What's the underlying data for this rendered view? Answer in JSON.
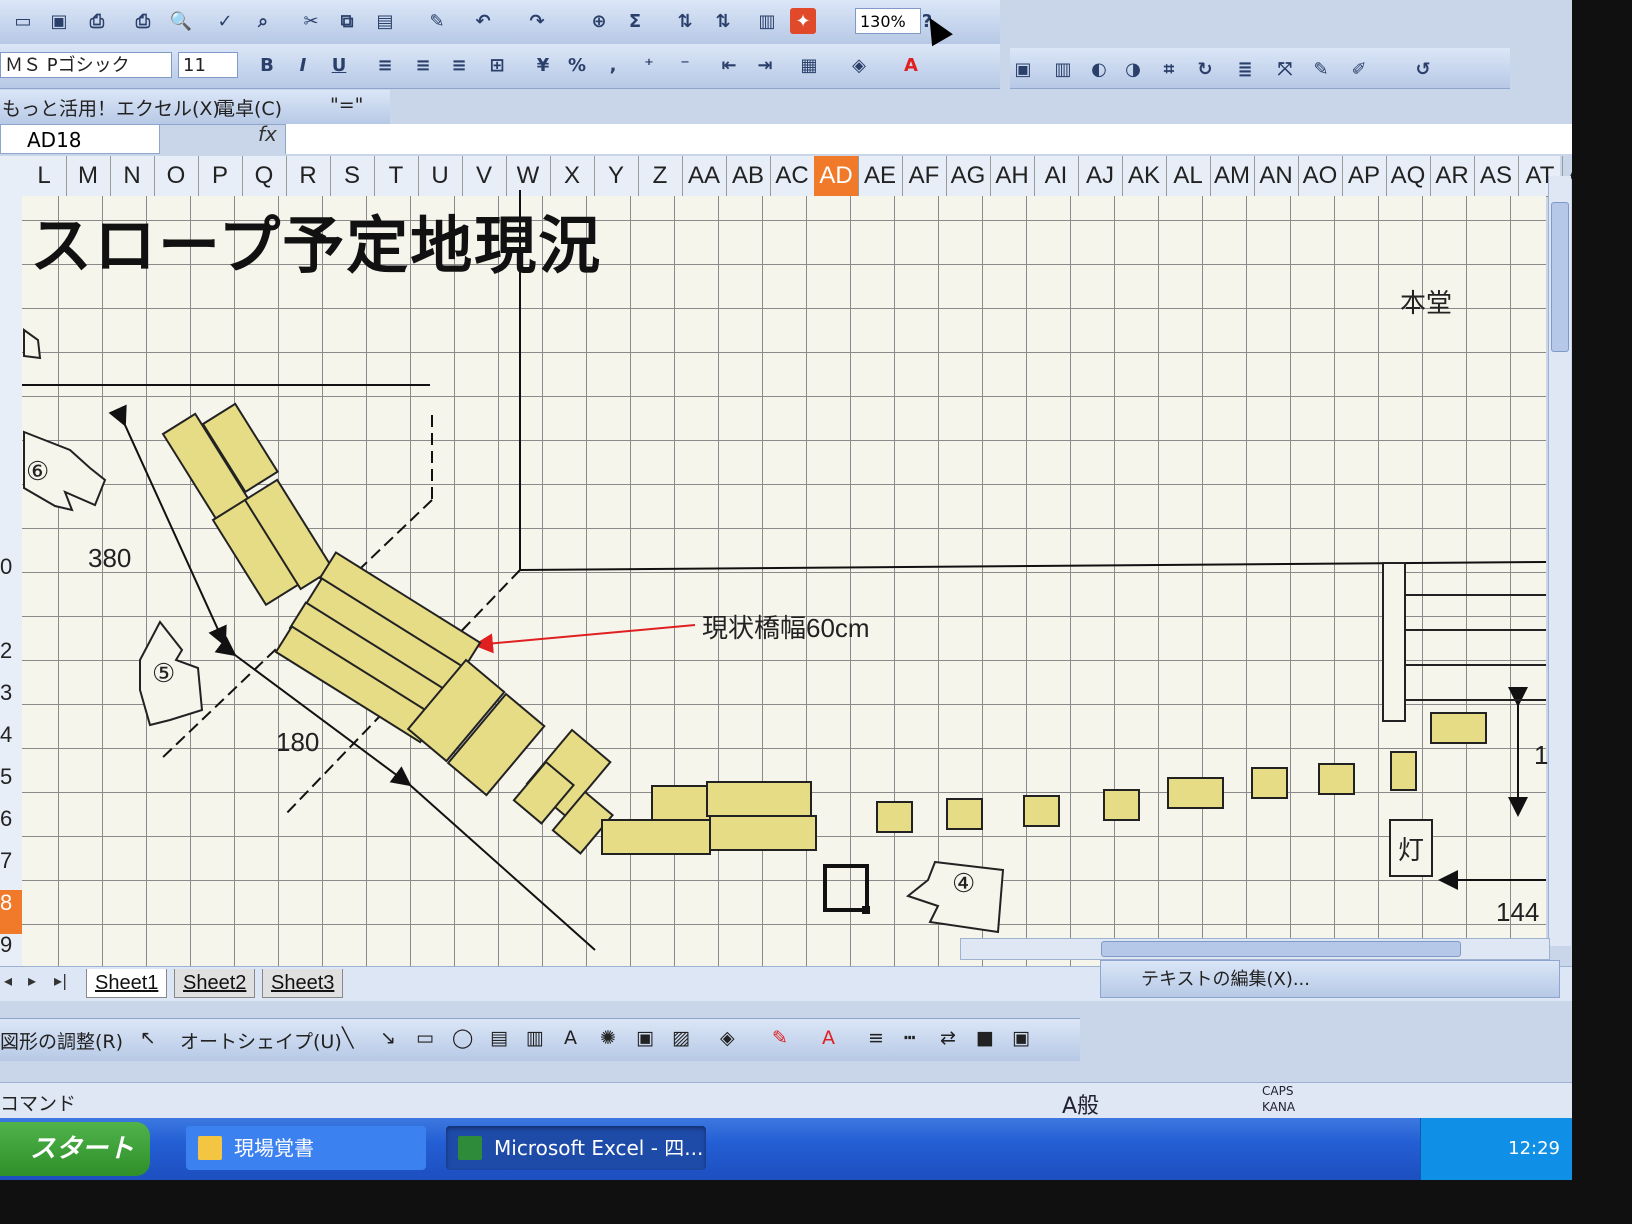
{
  "toolbar": {
    "zoom": "130%",
    "font_name": "ＭＳ Pゴシック",
    "font_size": "11",
    "bold": "B",
    "italic": "I",
    "underline": "U",
    "percent": "%",
    "comma": ",",
    "sigma": "Σ",
    "help": "?",
    "extra_menu": "もっと活用！エクセル(X)",
    "calc_menu": "電卓(C)",
    "equals_button": "\"=\""
  },
  "formula_bar": {
    "name_box": "AD18",
    "fx": "fx"
  },
  "columns": [
    "L",
    "M",
    "N",
    "O",
    "P",
    "Q",
    "R",
    "S",
    "T",
    "U",
    "V",
    "W",
    "X",
    "Y",
    "Z",
    "AA",
    "AB",
    "AC",
    "AD",
    "AE",
    "AF",
    "AG",
    "AH",
    "AI",
    "AJ",
    "AK",
    "AL",
    "AM",
    "AN",
    "AO",
    "AP",
    "AQ",
    "AR",
    "AS",
    "AT",
    "AU"
  ],
  "active_column": "AD",
  "rows": [
    "",
    "",
    "",
    "",
    "",
    "",
    "",
    "",
    "",
    "0",
    "",
    "2",
    "3",
    "4",
    "5",
    "6",
    "7",
    "8",
    "9"
  ],
  "active_row": "8",
  "sheet": {
    "title": "スロープ予定地現況",
    "labels": {
      "honDo": "本堂",
      "bridge_width": "現状橋幅60cm",
      "dim_380": "380",
      "dim_180": "180",
      "dim_1": "1",
      "dim_144": "144",
      "lamp": "灯",
      "marker_6": "⑥",
      "marker_5": "⑤",
      "marker_4": "④"
    }
  },
  "sheet_tabs": [
    "Sheet1",
    "Sheet2",
    "Sheet3"
  ],
  "text_toolbar": {
    "edit_text": "テキストの編集(X)..."
  },
  "draw_toolbar": {
    "draw_menu": "図形の調整(R)",
    "autoshape_menu": "オートシェイプ(U)"
  },
  "status": {
    "mode": "コマンド",
    "ime": "A般",
    "caps": "CAPS",
    "kana": "KANA"
  },
  "taskbar": {
    "start": "スタート",
    "item1": "現場覚書",
    "item2": "Microsoft Excel - 四...",
    "clock": "12:29"
  },
  "colors": {
    "active_header": "#f07a2a",
    "plank_fill": "#e6dc86",
    "arrow_red": "#e02020"
  }
}
